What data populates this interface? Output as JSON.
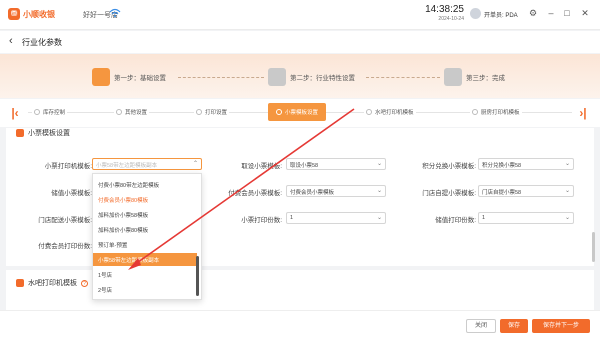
{
  "statusbar": {
    "app_name": "小顺收银",
    "store_name": "好好一号店",
    "time": "14:38:25",
    "date": "2024-10-24",
    "user": "开单员: PDA"
  },
  "header": {
    "title": "行业化参数"
  },
  "steps": [
    {
      "label": "第一步：基础设置"
    },
    {
      "label": "第二步：行业特性设置"
    },
    {
      "label": "第三步：完成"
    }
  ],
  "tabs": [
    {
      "label": "库存控制"
    },
    {
      "label": "其他设置"
    },
    {
      "label": "打印设置"
    },
    {
      "label": "小票模板设置"
    },
    {
      "label": "水吧打印机模板"
    },
    {
      "label": "厨房打印机模板"
    }
  ],
  "section1": {
    "title": "小票模板设置",
    "fields": {
      "printer_template": {
        "label": "小票打印机模板:",
        "placeholder": "小票58带左边距模板副本"
      },
      "pickup_template": {
        "label": "取设小票模板:",
        "value": "取设小票58"
      },
      "points_template": {
        "label": "积分兑换小票模板:",
        "value": "积分兑换小票58"
      },
      "stored_template": {
        "label": "储值小票模板:"
      },
      "member_template": {
        "label": "付费会员小票模板:",
        "value": "付费会员小票模板"
      },
      "store_pickup_template": {
        "label": "门店自提小票模板:",
        "value": "门店自提小票58"
      },
      "delivery_template": {
        "label": "门店配送小票模板:"
      },
      "receipt_copies": {
        "label": "小票打印份数:",
        "value": "1"
      },
      "stored_copies": {
        "label": "储值打印份数:",
        "value": "1"
      },
      "member_copies": {
        "label": "付费会员打印份数:"
      }
    }
  },
  "dropdown": {
    "items": [
      {
        "label": "付费小票80带左边距模板",
        "state": "normal"
      },
      {
        "label": "付费会员小票80模板",
        "state": "selected"
      },
      {
        "label": "加料加价小票58模板",
        "state": "normal"
      },
      {
        "label": "加料加价小票80模板",
        "state": "normal"
      },
      {
        "label": "预订单-预置",
        "state": "normal"
      },
      {
        "label": "小票58带左边距模板副本",
        "state": "highlight"
      },
      {
        "label": "1号店",
        "state": "normal"
      },
      {
        "label": "2号店",
        "state": "normal"
      }
    ]
  },
  "section2": {
    "title": "水吧打印机模板"
  },
  "footer": {
    "close": "关闭",
    "save": "保存",
    "save_next": "保存并下一步"
  },
  "colors": {
    "accent": "#f26b2b",
    "tab_active": "#f5963f",
    "annotation_arrow": "#e53935"
  }
}
